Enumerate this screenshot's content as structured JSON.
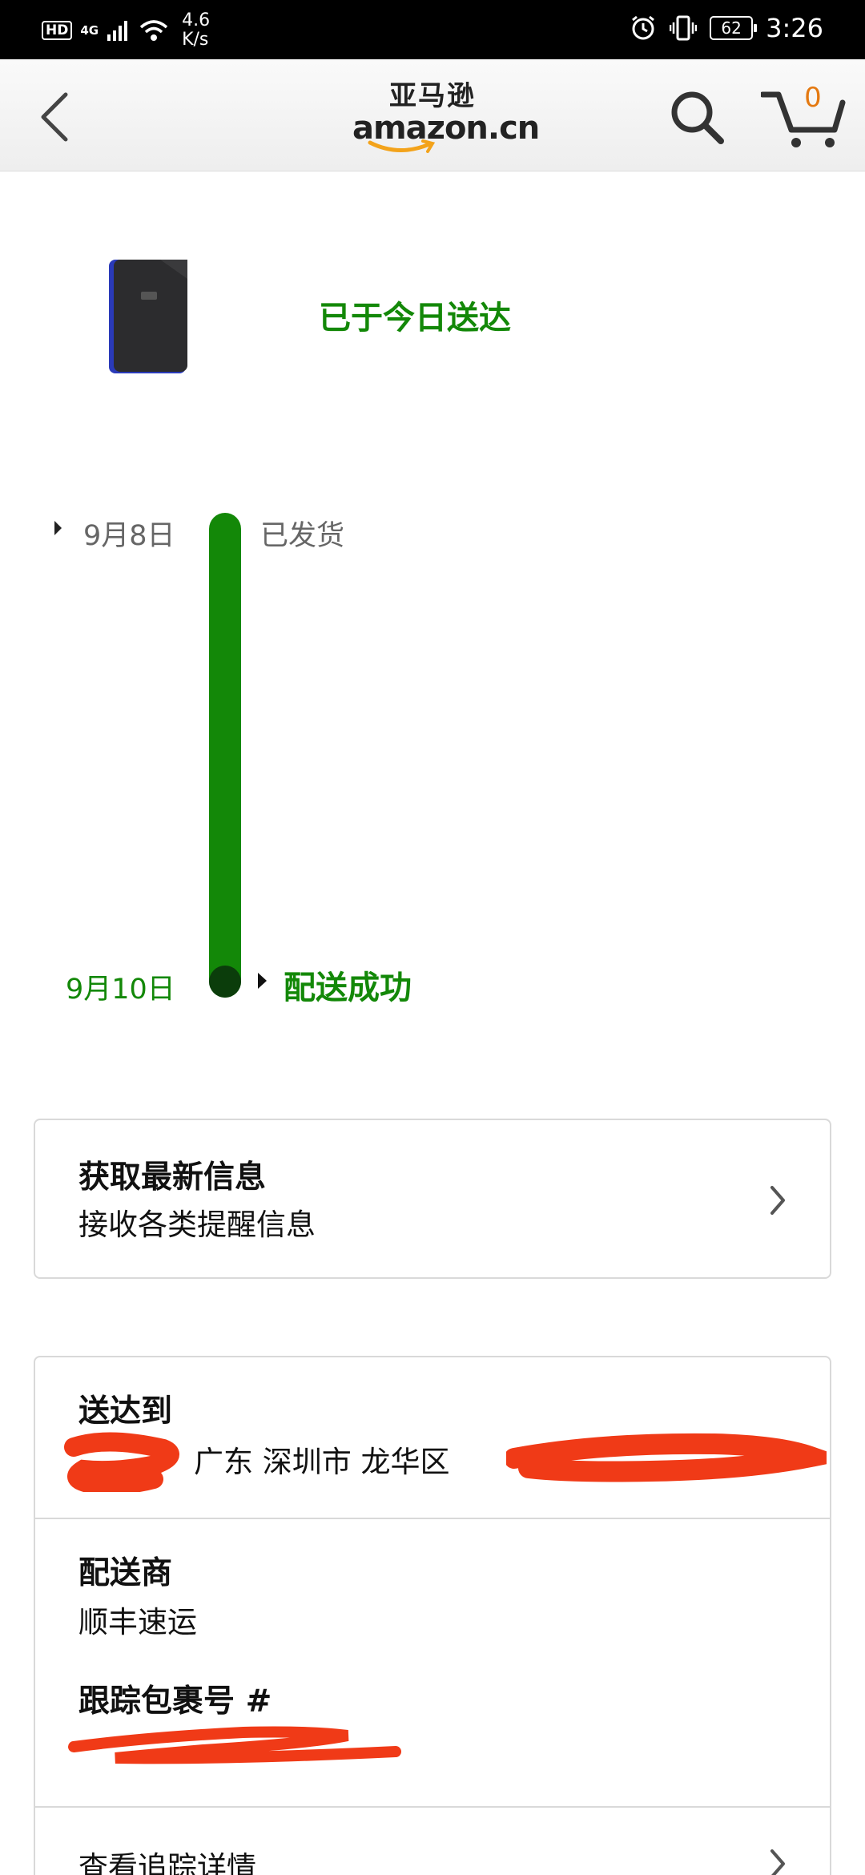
{
  "status_bar": {
    "hd": "HD",
    "network": "4G",
    "speed_value": "4.6",
    "speed_unit": "K/s",
    "battery": "62",
    "time": "3:26"
  },
  "header": {
    "logo_cn": "亚马逊",
    "logo_en": "amazon.cn",
    "cart_count": "0"
  },
  "delivery": {
    "headline": "已于今日送达",
    "timeline": [
      {
        "date": "9月8日",
        "label": "已发货"
      },
      {
        "date": "9月10日",
        "label": "配送成功"
      }
    ]
  },
  "alerts_card": {
    "title": "获取最新信息",
    "subtitle": "接收各类提醒信息"
  },
  "shipping_card": {
    "deliver_to_label": "送达到",
    "address_visible": "广东 深圳市 龙华区",
    "carrier_label": "配送商",
    "carrier": "顺丰速运",
    "tracking_label": "跟踪包裹号 #",
    "view_tracking": "查看追踪详情"
  },
  "colors": {
    "accent_green": "#138808",
    "cart_orange": "#e47911",
    "redaction_red": "#f03a17"
  },
  "icons": [
    "back-arrow-icon",
    "search-icon",
    "cart-icon",
    "chevron-right-icon",
    "alarm-icon",
    "vibrate-icon",
    "wifi-icon",
    "signal-icon",
    "battery-icon"
  ]
}
